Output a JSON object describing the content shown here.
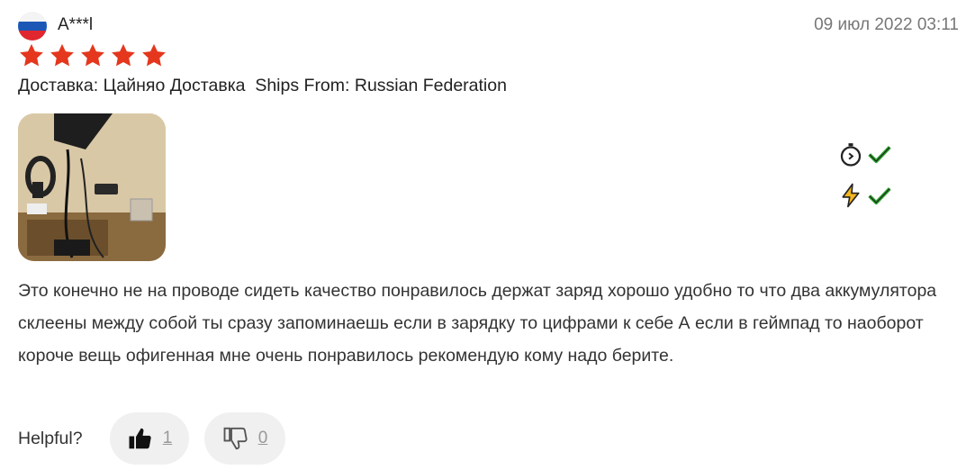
{
  "review": {
    "country_flag_colors": [
      "#ffffff",
      "#1c57b6",
      "#e0262e"
    ],
    "user_name": "A***l",
    "date": "09 июл 2022 03:11",
    "rating": 5,
    "shipping_line": "Доставка: Цайняо Доставка  Ships From: Russian Federation",
    "photo_icon": "product-photo",
    "badges": [
      {
        "icon": "stopwatch-icon",
        "status": "check-icon"
      },
      {
        "icon": "lightning-icon",
        "status": "check-icon"
      }
    ],
    "text": "Это конечно не на проводе сидеть качество понравилось держат заряд хорошо удобно то что два аккумулятора склеены между собой ты сразу запоминаешь если в зарядку то цифрами к себе А если в геймпад то наоборот короче вещь офигенная мне очень понравилось рекомендую кому надо берите."
  },
  "helpful": {
    "label": "Helpful?",
    "up_count": "1",
    "down_count": "0"
  },
  "colors": {
    "star": "#e4371d",
    "check": "#2ca32c",
    "lightning": "#f2b61f"
  }
}
